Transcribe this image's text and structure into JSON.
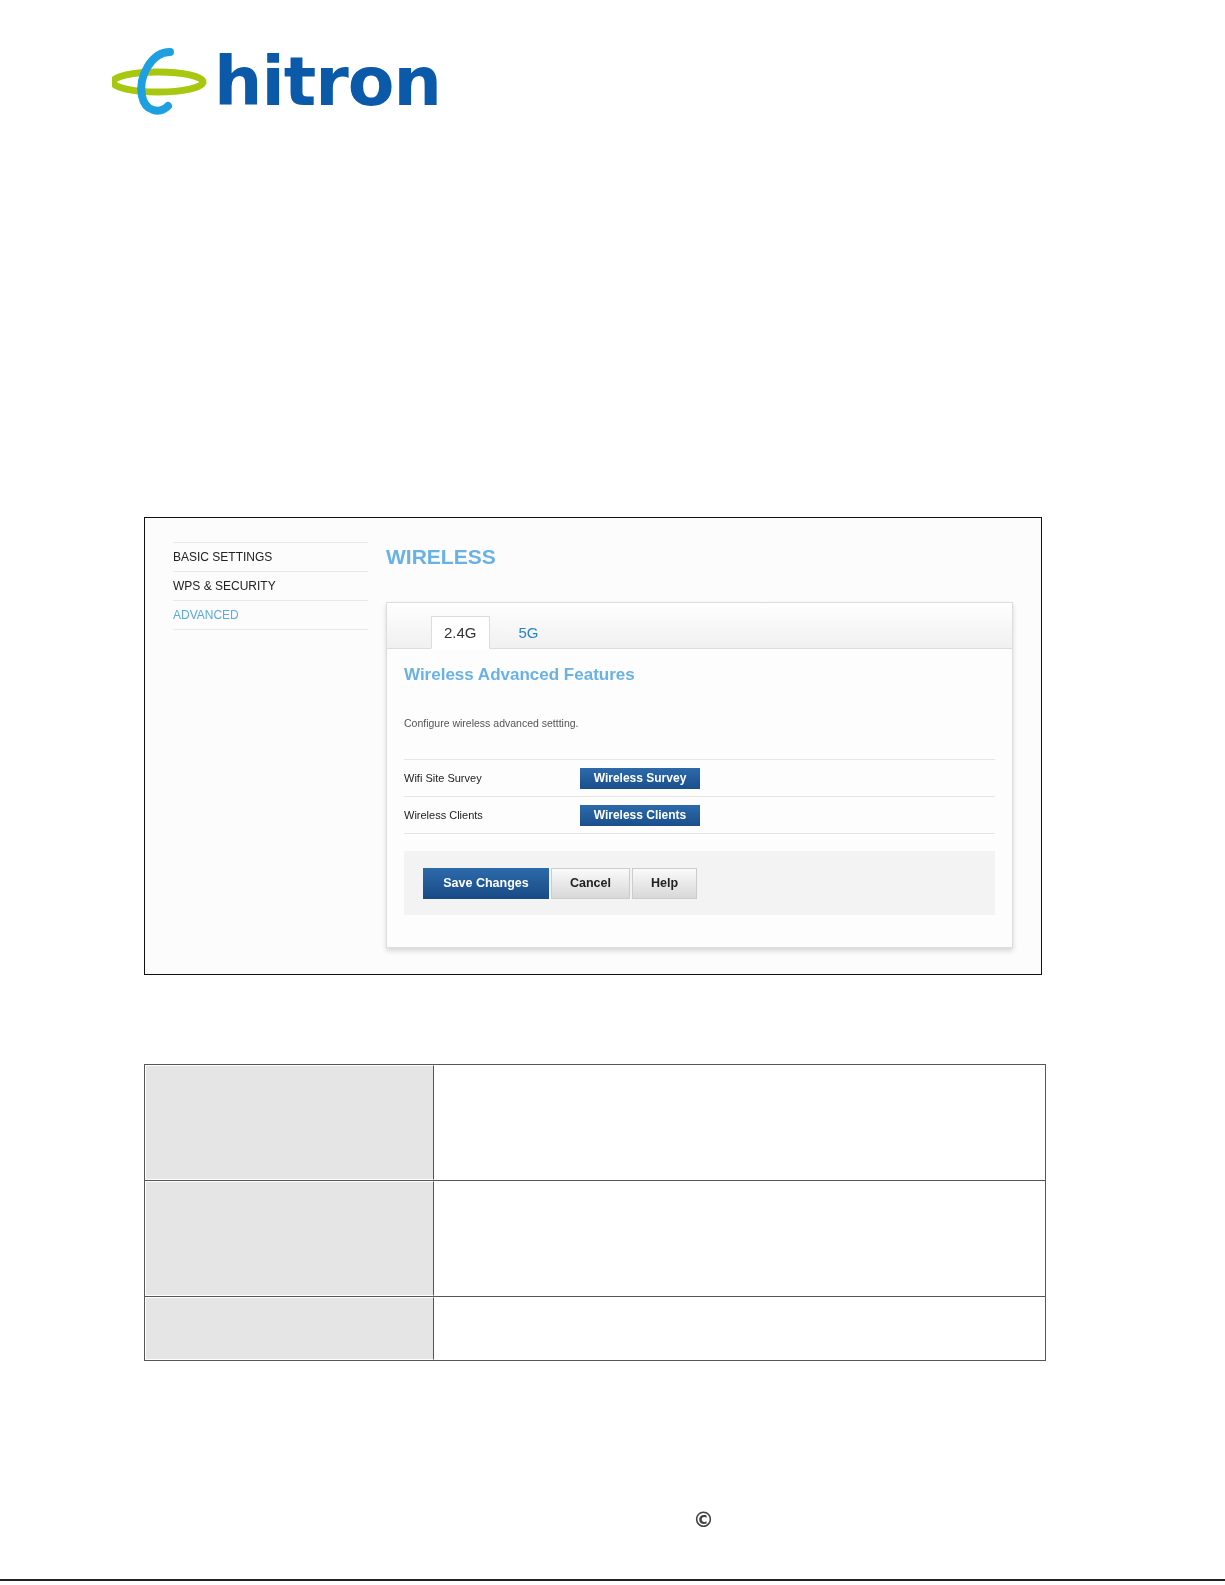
{
  "logo": {
    "text": "hitron"
  },
  "sidebar": {
    "items": [
      {
        "label": "BASIC SETTINGS",
        "selected": false
      },
      {
        "label": "WPS & SECURITY",
        "selected": false
      },
      {
        "label": "ADVANCED",
        "selected": true
      }
    ]
  },
  "page_title": "WIRELESS",
  "tabs": [
    {
      "label": "2.4G",
      "selected": true
    },
    {
      "label": "5G",
      "selected": false
    }
  ],
  "section": {
    "title": "Wireless Advanced Features",
    "description": "Configure wireless advanced settting."
  },
  "rows": [
    {
      "label": "Wifi Site Survey",
      "button": "Wireless Survey"
    },
    {
      "label": "Wireless Clients",
      "button": "Wireless Clients"
    }
  ],
  "actions": [
    {
      "label": "Save Changes",
      "kind": "primary"
    },
    {
      "label": "Cancel",
      "kind": "default"
    },
    {
      "label": "Help",
      "kind": "default"
    }
  ],
  "footer": {
    "copyright": "©"
  }
}
